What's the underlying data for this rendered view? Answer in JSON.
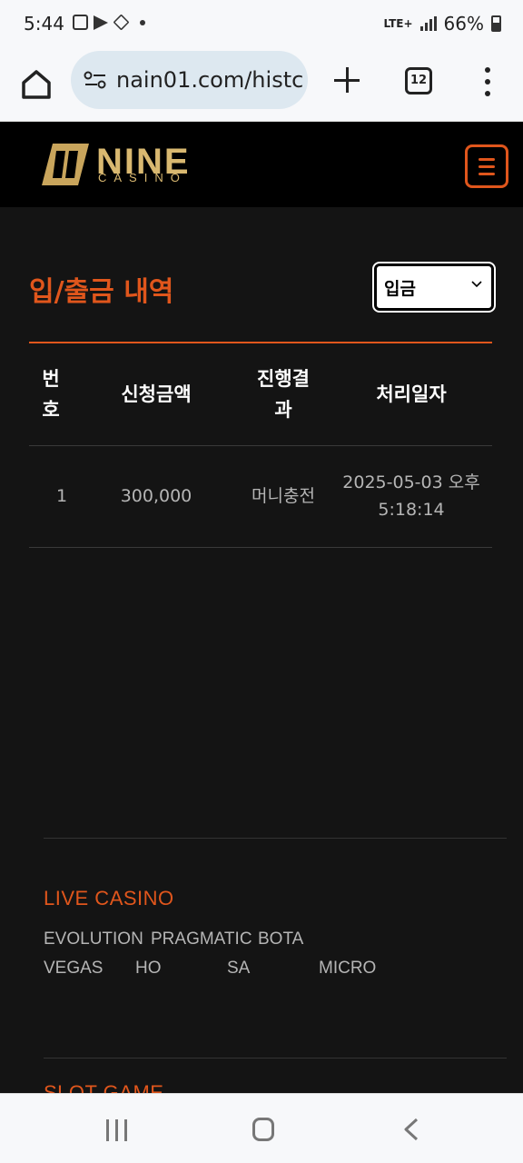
{
  "status_bar": {
    "time": "5:44",
    "network": "LTE+",
    "battery": "66%"
  },
  "browser": {
    "url": "nain01.com/histc",
    "tab_count": "12"
  },
  "site": {
    "logo_text": "NINE",
    "logo_sub": "CASINO",
    "accent_color": "#e0561c"
  },
  "page": {
    "title": "입/출금 내역",
    "filter_selected": "입금"
  },
  "table": {
    "headers": [
      "번\n호",
      "신청금액",
      "진행결\n과",
      "처리일자"
    ],
    "rows": [
      {
        "no": "1",
        "amount": "300,000",
        "result": "머니충전",
        "date": "2025-05-03 오후\n5:18:14"
      }
    ]
  },
  "footer": {
    "live_casino_title": "LIVE CASINO",
    "live_providers": [
      "EVOLUTION",
      "PRAGMATIC",
      "BOTA",
      "VEGAS",
      "HO",
      "SA",
      "MICRO"
    ],
    "slot_game_title": "SLOT GAME"
  }
}
